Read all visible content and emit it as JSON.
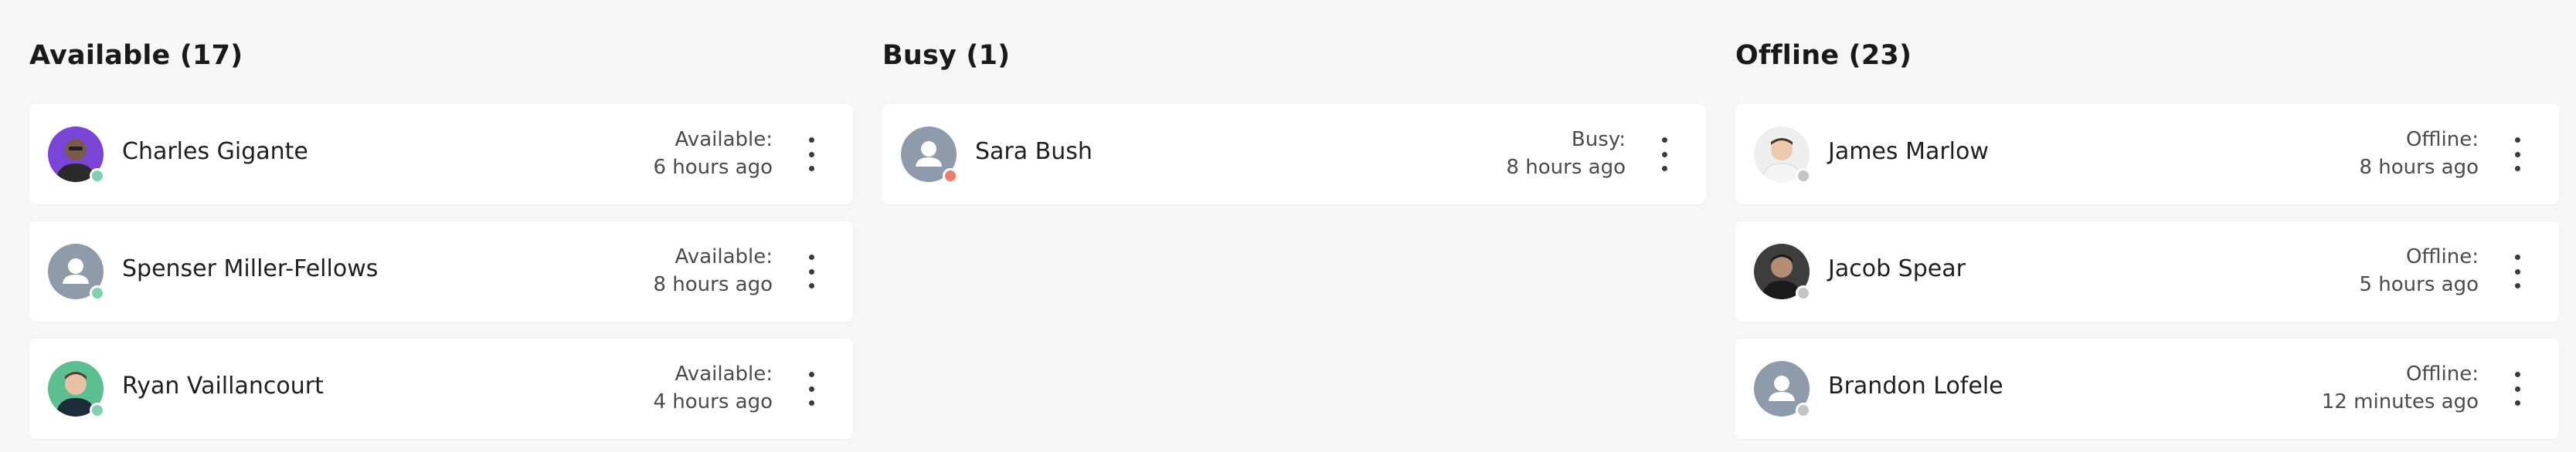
{
  "columns": [
    {
      "title": "Available (17)",
      "dot_color": "#7fd1b0",
      "users": [
        {
          "name": "Charles Gigante",
          "status_label": "Available:",
          "time": "6 hours ago",
          "avatar": "photo-purple"
        },
        {
          "name": "Spenser Miller-Fellows",
          "status_label": "Available:",
          "time": "8 hours ago",
          "avatar": "placeholder"
        },
        {
          "name": "Ryan Vaillancourt",
          "status_label": "Available:",
          "time": "4 hours ago",
          "avatar": "photo-green"
        }
      ]
    },
    {
      "title": "Busy (1)",
      "dot_color": "#ef7b6d",
      "users": [
        {
          "name": "Sara Bush",
          "status_label": "Busy:",
          "time": "8 hours ago",
          "avatar": "placeholder"
        }
      ]
    },
    {
      "title": "Offline (23)",
      "dot_color": "#c4c4c4",
      "users": [
        {
          "name": "James Marlow",
          "status_label": "Offline:",
          "time": "8 hours ago",
          "avatar": "photo-light"
        },
        {
          "name": "Jacob Spear",
          "status_label": "Offline:",
          "time": "5 hours ago",
          "avatar": "photo-dark"
        },
        {
          "name": "Brandon Lofele",
          "status_label": "Offline:",
          "time": "12 minutes ago",
          "avatar": "placeholder"
        }
      ]
    }
  ],
  "icons": {
    "menu": "kebab-menu-icon",
    "placeholder_avatar": "user-placeholder-icon"
  }
}
